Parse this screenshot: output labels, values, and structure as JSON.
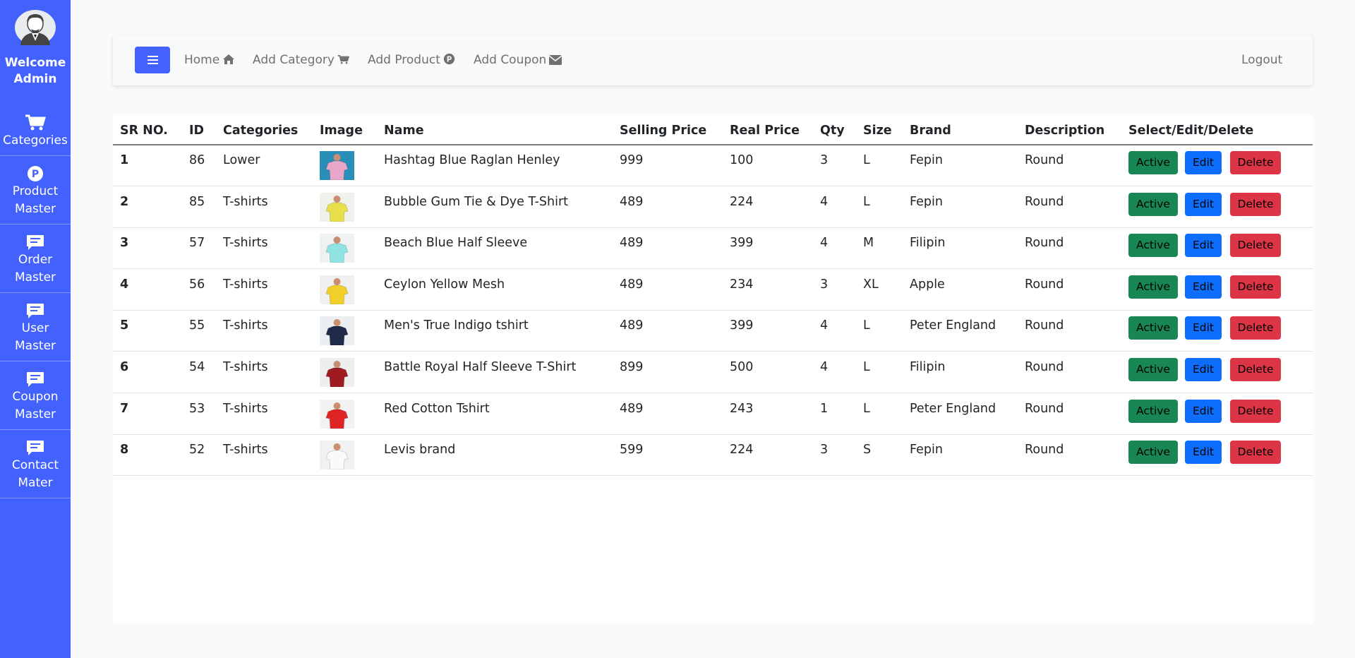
{
  "sidebar": {
    "welcome": "Welcome Admin",
    "items": [
      {
        "label1": "Categories",
        "label2": "",
        "icon": "cart-icon"
      },
      {
        "label1": "Product",
        "label2": "Master",
        "icon": "product-p-icon"
      },
      {
        "label1": "Order",
        "label2": "Master",
        "icon": "message-icon"
      },
      {
        "label1": "User",
        "label2": "Master",
        "icon": "message-icon"
      },
      {
        "label1": "Coupon",
        "label2": "Master",
        "icon": "message-icon"
      },
      {
        "label1": "Contact",
        "label2": "Mater",
        "icon": "message-icon"
      }
    ]
  },
  "navbar": {
    "home": "Home",
    "add_category": "Add Category",
    "add_product": "Add Product",
    "add_coupon": "Add Coupon",
    "logout": "Logout"
  },
  "table": {
    "headers": [
      "SR NO.",
      "ID",
      "Categories",
      "Image",
      "Name",
      "Selling Price",
      "Real Price",
      "Qty",
      "Size",
      "Brand",
      "Description",
      "Select/Edit/Delete"
    ],
    "rows": [
      {
        "sr": "1",
        "id": "86",
        "category": "Lower",
        "name": "Hashtag Blue Raglan Henley",
        "selling": "999",
        "real": "100",
        "qty": "3",
        "size": "L",
        "brand": "Fepin",
        "desc": "Round",
        "active": "Active",
        "edit": "Edit",
        "delete": "Delete",
        "img_bg": "#2a8fb8",
        "img_fg": "#e8a6c8"
      },
      {
        "sr": "2",
        "id": "85",
        "category": "T-shirts",
        "name": "Bubble Gum Tie & Dye T-Shirt",
        "selling": "489",
        "real": "224",
        "qty": "4",
        "size": "L",
        "brand": "Fepin",
        "desc": "Round",
        "active": "Active",
        "edit": "Edit",
        "delete": "Delete",
        "img_bg": "#f1f1ec",
        "img_fg": "#e8e04a"
      },
      {
        "sr": "3",
        "id": "57",
        "category": "T-shirts",
        "name": "Beach Blue Half Sleeve",
        "selling": "489",
        "real": "399",
        "qty": "4",
        "size": "M",
        "brand": "Filipin",
        "desc": "Round",
        "active": "Active",
        "edit": "Edit",
        "delete": "Delete",
        "img_bg": "#eef2f2",
        "img_fg": "#8fe3e3"
      },
      {
        "sr": "4",
        "id": "56",
        "category": "T-shirts",
        "name": "Ceylon Yellow Mesh",
        "selling": "489",
        "real": "234",
        "qty": "3",
        "size": "XL",
        "brand": "Apple",
        "desc": "Round",
        "active": "Active",
        "edit": "Edit",
        "delete": "Delete",
        "img_bg": "#f0f0ee",
        "img_fg": "#f0cf2a"
      },
      {
        "sr": "5",
        "id": "55",
        "category": "T-shirts",
        "name": "Men's True Indigo tshirt",
        "selling": "489",
        "real": "399",
        "qty": "4",
        "size": "L",
        "brand": "Peter England",
        "desc": "Round",
        "active": "Active",
        "edit": "Edit",
        "delete": "Delete",
        "img_bg": "#eceff2",
        "img_fg": "#1f2b48"
      },
      {
        "sr": "6",
        "id": "54",
        "category": "T-shirts",
        "name": "Battle Royal Half Sleeve T-Shirt",
        "selling": "899",
        "real": "500",
        "qty": "4",
        "size": "L",
        "brand": "Filipin",
        "desc": "Round",
        "active": "Active",
        "edit": "Edit",
        "delete": "Delete",
        "img_bg": "#eeeeee",
        "img_fg": "#9e1b22"
      },
      {
        "sr": "7",
        "id": "53",
        "category": "T-shirts",
        "name": "Red Cotton Tshirt",
        "selling": "489",
        "real": "243",
        "qty": "1",
        "size": "L",
        "brand": "Peter England",
        "desc": "Round",
        "active": "Active",
        "edit": "Edit",
        "delete": "Delete",
        "img_bg": "#f2f2f2",
        "img_fg": "#e02424"
      },
      {
        "sr": "8",
        "id": "52",
        "category": "T-shirts",
        "name": "Levis brand",
        "selling": "599",
        "real": "224",
        "qty": "3",
        "size": "S",
        "brand": "Fepin",
        "desc": "Round",
        "active": "Active",
        "edit": "Edit",
        "delete": "Delete",
        "img_bg": "#f1f1f1",
        "img_fg": "#fafafa"
      }
    ]
  },
  "colors": {
    "sidebar": "#4361fd",
    "active": "#198754",
    "edit": "#0d6efd",
    "delete": "#dc3545"
  }
}
